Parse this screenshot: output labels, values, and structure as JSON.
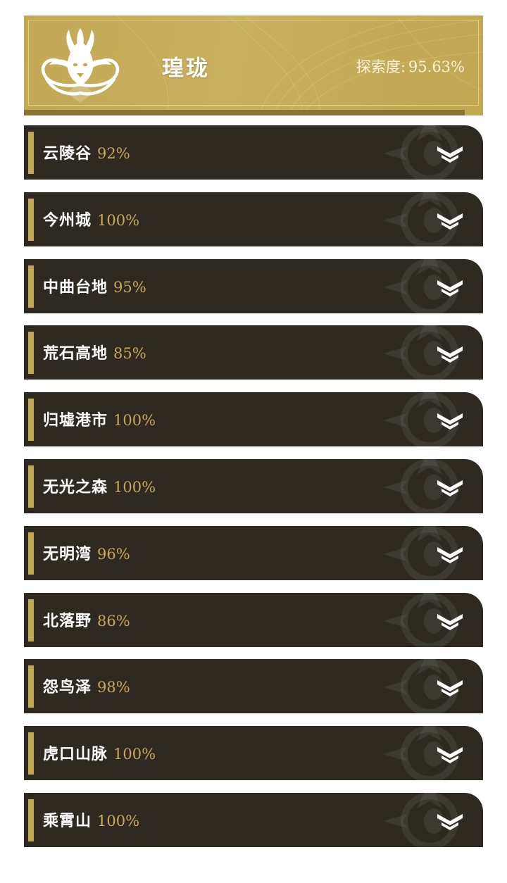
{
  "header": {
    "title": "瑝珑",
    "exploration_label": "探索度:",
    "exploration_value": "95.63%",
    "emblem_icon": "dragon-emblem-icon",
    "accent_color": "#c3a955"
  },
  "areas": [
    {
      "name": "云陵谷",
      "percent": "92%"
    },
    {
      "name": "今州城",
      "percent": "100%"
    },
    {
      "name": "中曲台地",
      "percent": "95%"
    },
    {
      "name": "荒石高地",
      "percent": "85%"
    },
    {
      "name": "归墟港市",
      "percent": "100%"
    },
    {
      "name": "无光之森",
      "percent": "100%"
    },
    {
      "name": "无明湾",
      "percent": "96%"
    },
    {
      "name": "北落野",
      "percent": "86%"
    },
    {
      "name": "怨鸟泽",
      "percent": "98%"
    },
    {
      "name": "虎口山脉",
      "percent": "100%"
    },
    {
      "name": "乘霄山",
      "percent": "100%"
    }
  ],
  "row_style": {
    "background": "#2e2a22",
    "accent": "#c2a755",
    "percent_color": "#c9a85a",
    "expand_icon": "chevron-down-icon"
  }
}
